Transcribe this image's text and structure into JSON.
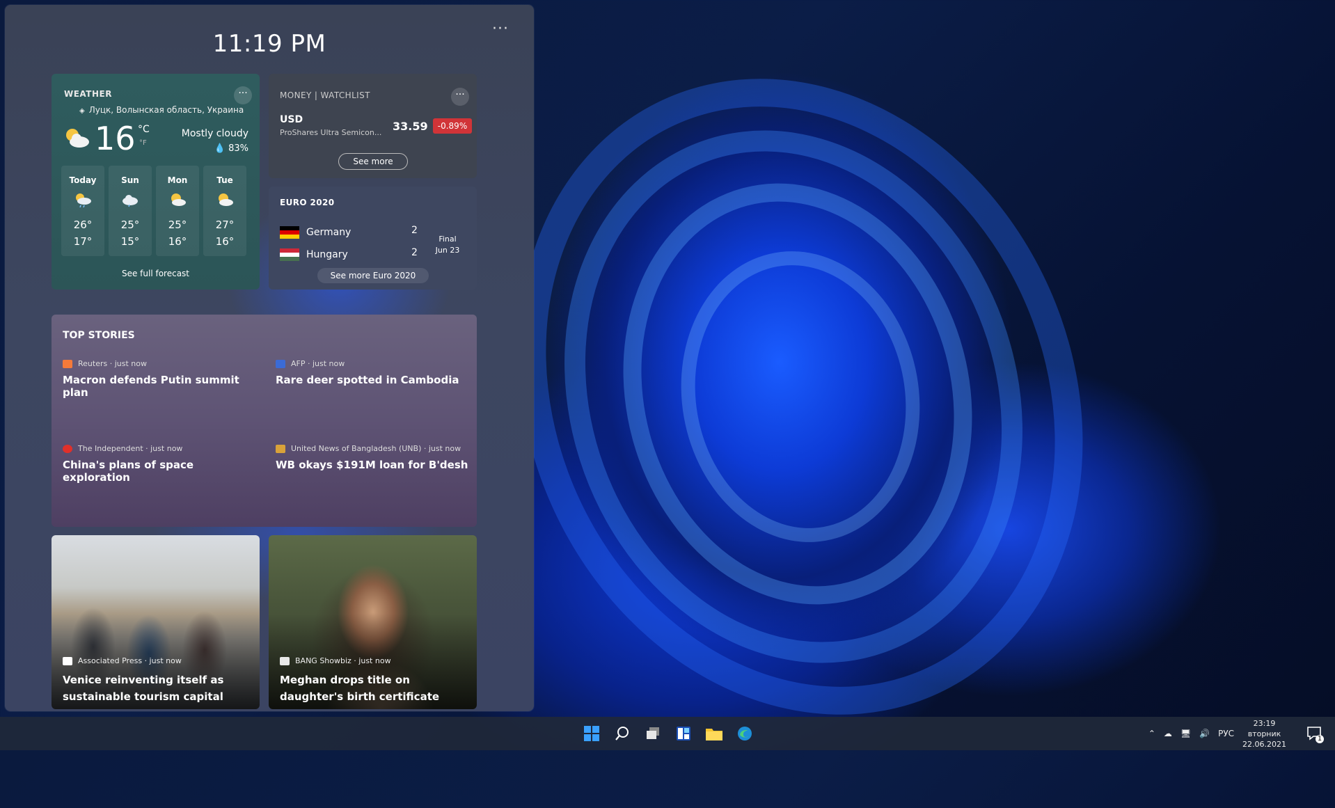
{
  "panel": {
    "time": "11:19 PM",
    "more_label": "···"
  },
  "weather": {
    "title": "WEATHER",
    "more_label": "···",
    "location": "Луцк, Волынская область, Украина",
    "temperature": "16",
    "unit_c": "°C",
    "unit_f": "°F",
    "condition": "Mostly cloudy",
    "humidity": "83%",
    "days": [
      {
        "name": "Today",
        "high": "26°",
        "low": "17°",
        "icon": "partly-cloudy-rain-icon"
      },
      {
        "name": "Sun",
        "high": "25°",
        "low": "15°",
        "icon": "cloudy-icon"
      },
      {
        "name": "Mon",
        "high": "25°",
        "low": "16°",
        "icon": "partly-sunny-icon"
      },
      {
        "name": "Tue",
        "high": "27°",
        "low": "16°",
        "icon": "partly-sunny-icon"
      }
    ],
    "forecast_link": "See full forecast"
  },
  "money": {
    "title": "MONEY | WATCHLIST",
    "more_label": "···",
    "symbol": "USD",
    "name": "ProShares Ultra Semicon...",
    "price": "33.59",
    "change": "-0.89%",
    "see_more": "See more",
    "change_color": "#d13438"
  },
  "euro": {
    "title": "EURO 2020",
    "teams": [
      {
        "name": "Germany",
        "score": "2"
      },
      {
        "name": "Hungary",
        "score": "2"
      }
    ],
    "status": "Final",
    "date": "Jun 23",
    "see_more": "See more Euro 2020"
  },
  "top_stories": {
    "title": "TOP STORIES",
    "stories": [
      {
        "source": "Reuters · just now",
        "headline": "Macron defends Putin summit plan"
      },
      {
        "source": "AFP · just now",
        "headline": "Rare deer spotted in Cambodia"
      },
      {
        "source": "The Independent · just now",
        "headline": "China's plans of space exploration"
      },
      {
        "source": "United News of Bangladesh (UNB) · just now",
        "headline": "WB okays $191M loan for B'desh"
      }
    ]
  },
  "image_cards": [
    {
      "source": "Associated Press · just now",
      "headline": "Venice reinventing itself as sustainable tourism capital"
    },
    {
      "source": "BANG Showbiz · just now",
      "headline": "Meghan drops title on daughter's birth certificate"
    }
  ],
  "taskbar": {
    "apps": [
      "windows-start-icon",
      "search-icon",
      "task-view-icon",
      "widgets-icon",
      "file-explorer-icon",
      "edge-icon"
    ],
    "language": "РУС",
    "time": "23:19",
    "day": "вторник",
    "date": "22.06.2021",
    "notification_count": "1"
  }
}
